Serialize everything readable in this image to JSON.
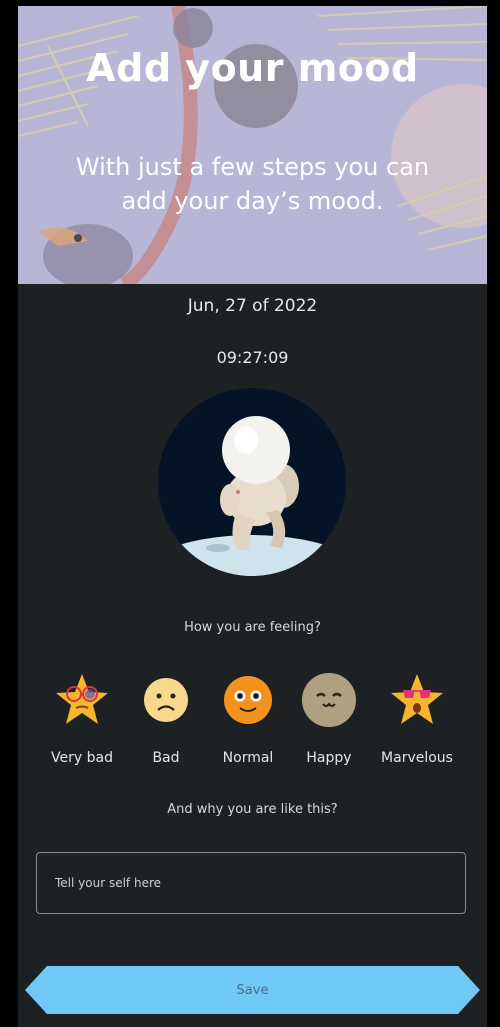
{
  "header": {
    "title": "Add your mood",
    "subtitle_line1": "With just a few steps you can",
    "subtitle_line2": "add your day’s mood."
  },
  "entry": {
    "date": "Jun, 27 of 2022",
    "time": "09:27:09"
  },
  "prompts": {
    "feeling": "How you are feeling?",
    "why": "And why you are like this?"
  },
  "moods": [
    {
      "label": "Very bad",
      "icon": "star-glasses-icon"
    },
    {
      "label": "Bad",
      "icon": "sad-face-icon"
    },
    {
      "label": "Normal",
      "icon": "neutral-face-icon"
    },
    {
      "label": "Happy",
      "icon": "happy-face-icon"
    },
    {
      "label": "Marvelous",
      "icon": "star-sunglasses-icon"
    }
  ],
  "note": {
    "placeholder": "Tell your self here"
  },
  "actions": {
    "save_label": "Save"
  },
  "colors": {
    "banner_bg": "#b8b6d6",
    "content_bg": "#1e2124",
    "save_button": "#6fc8f5",
    "avatar_bg": "#041325"
  }
}
